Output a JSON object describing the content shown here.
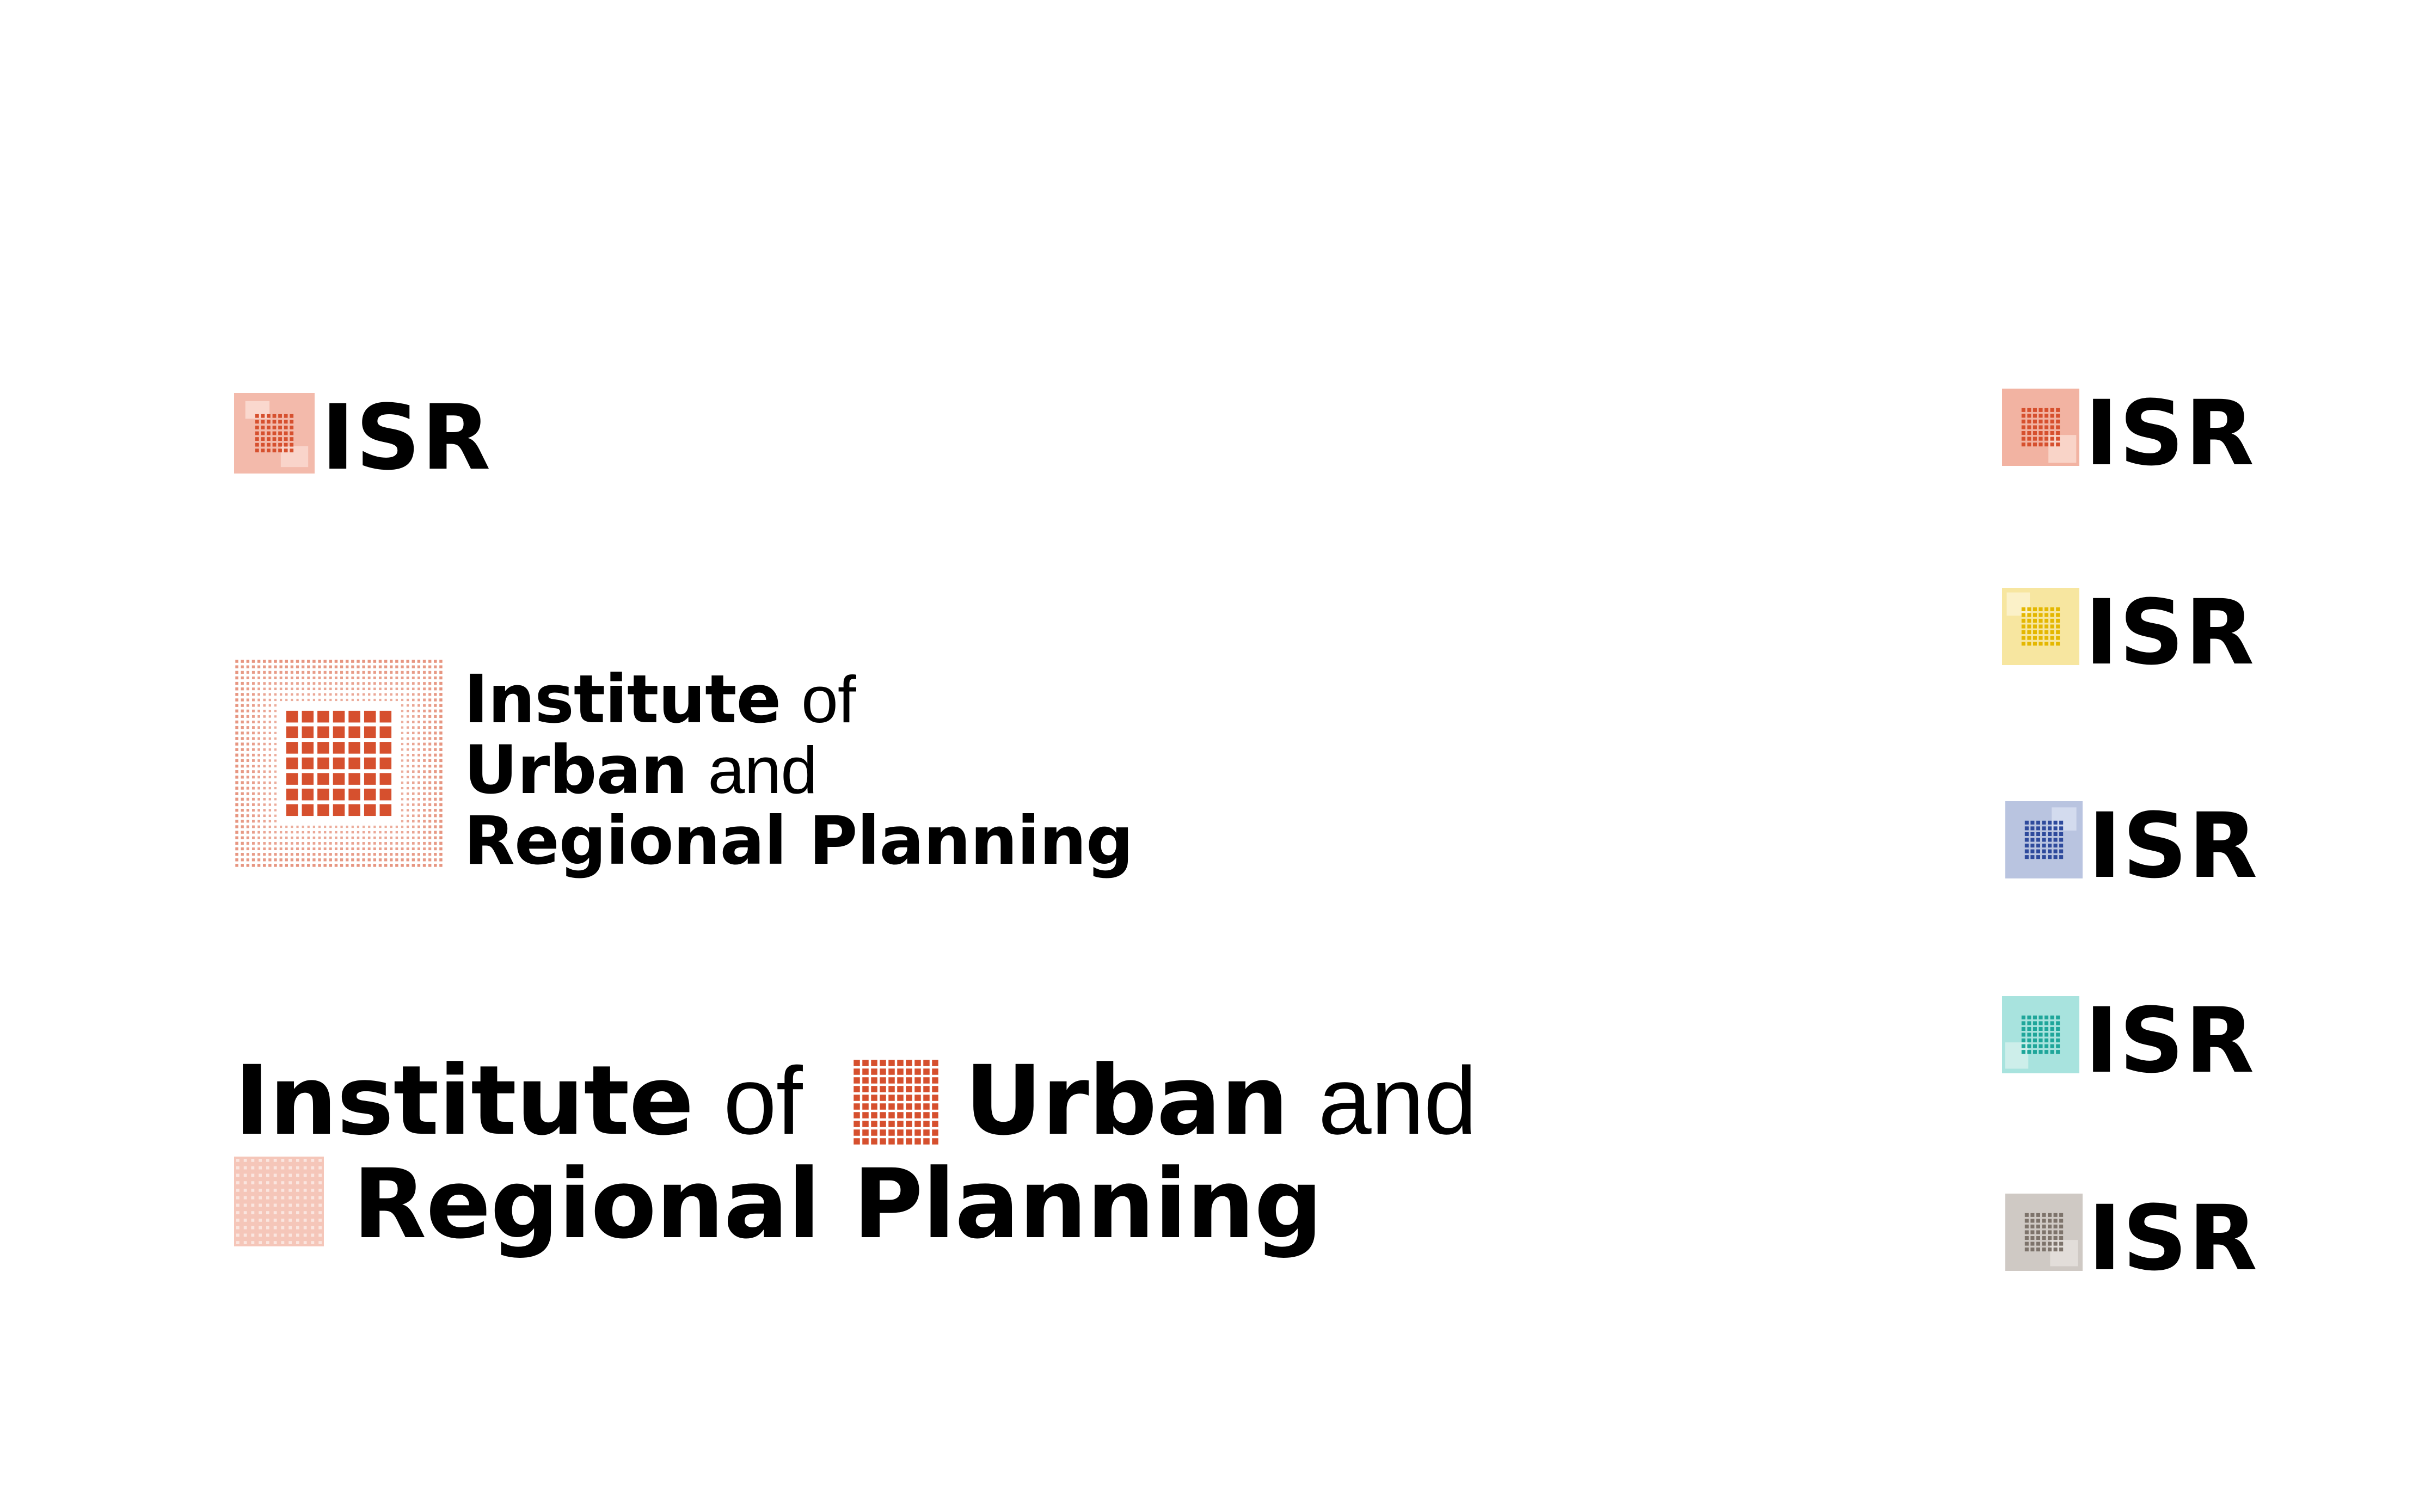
{
  "logos": {
    "abbrev_text": "ISR",
    "stacked": {
      "line1_bold": "Institute",
      "line1_light": "of",
      "line2_bold": "Urban",
      "line2_light": "and",
      "line3_bold": "Regional Planning"
    },
    "horizontal": {
      "line1_bold_a": "Institute",
      "line1_light_a": "of",
      "line1_bold_b": "Urban",
      "line1_light_b": "and",
      "line2_bold": "Regional Planning"
    }
  },
  "colors": {
    "red": "#d6502e",
    "red_light": "#f2b3a2",
    "yellow": "#e4b700",
    "yellow_light": "#f7e6a0",
    "blue": "#2e4a9c",
    "blue_light": "#b9c4e0",
    "teal": "#1fa69a",
    "teal_light": "#a8e3de",
    "grey": "#7d736b",
    "grey_light": "#cfc9c4"
  },
  "variants": [
    "red",
    "yellow",
    "blue",
    "teal",
    "grey"
  ]
}
